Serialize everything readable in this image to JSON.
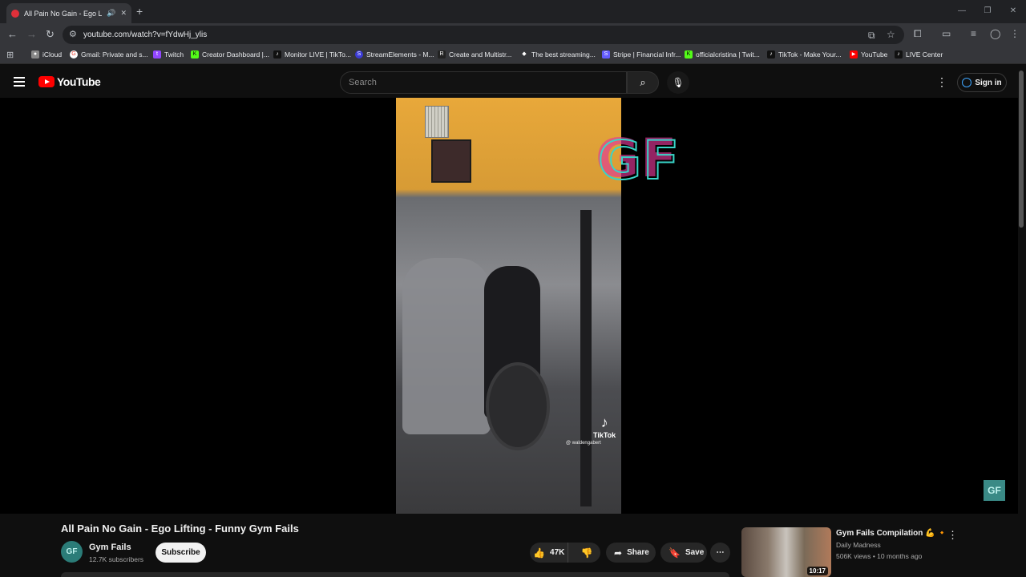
{
  "browser": {
    "tab_title": "All Pain No Gain - Ego Lifti",
    "url": "youtube.com/watch?v=fYdwHj_ylis",
    "bookmarks": [
      {
        "label": "iCloud",
        "color": "#888888",
        "glyph": ""
      },
      {
        "label": "Gmail: Private and s...",
        "color": "#ea4335",
        "glyph": "G"
      },
      {
        "label": "Twitch",
        "color": "#9146ff",
        "glyph": "t"
      },
      {
        "label": "Creator Dashboard |...",
        "color": "#53fc18",
        "glyph": "K"
      },
      {
        "label": "Monitor LIVE | TikTo...",
        "color": "#111111",
        "glyph": "♪"
      },
      {
        "label": "StreamElements - M...",
        "color": "#3b3bd6",
        "glyph": "S"
      },
      {
        "label": "Create and Multistr...",
        "color": "#222222",
        "glyph": "R"
      },
      {
        "label": "The best streaming...",
        "color": "#ffffff",
        "glyph": "◆"
      },
      {
        "label": "Stripe | Financial Infr...",
        "color": "#635bff",
        "glyph": "S"
      },
      {
        "label": "officialcristina | Twit...",
        "color": "#53fc18",
        "glyph": "K"
      },
      {
        "label": "TikTok - Make Your...",
        "color": "#111111",
        "glyph": "♪"
      },
      {
        "label": "YouTube",
        "color": "#ff0000",
        "glyph": "▶"
      },
      {
        "label": "LIVE Center",
        "color": "#111111",
        "glyph": "♪"
      }
    ]
  },
  "header": {
    "logo_text": "YouTube",
    "search_placeholder": "Search",
    "signin_label": "Sign in"
  },
  "video": {
    "overlay_brand": "GF",
    "tiktok_label": "TikTok",
    "tiktok_user": "@ waldengabert"
  },
  "watch": {
    "title": "All Pain No Gain - Ego Lifting - Funny Gym Fails",
    "channel_avatar_text": "GF",
    "channel_name": "Gym Fails",
    "channel_subs": "12.7K subscribers",
    "subscribe_label": "Subscribe",
    "like_count": "47K",
    "share_label": "Share",
    "save_label": "Save"
  },
  "recommendation": {
    "title": "Gym Fails Compilation 💪 🔸",
    "channel": "Daily Madness",
    "meta": "506K views • 10 months ago",
    "duration": "10:17"
  }
}
